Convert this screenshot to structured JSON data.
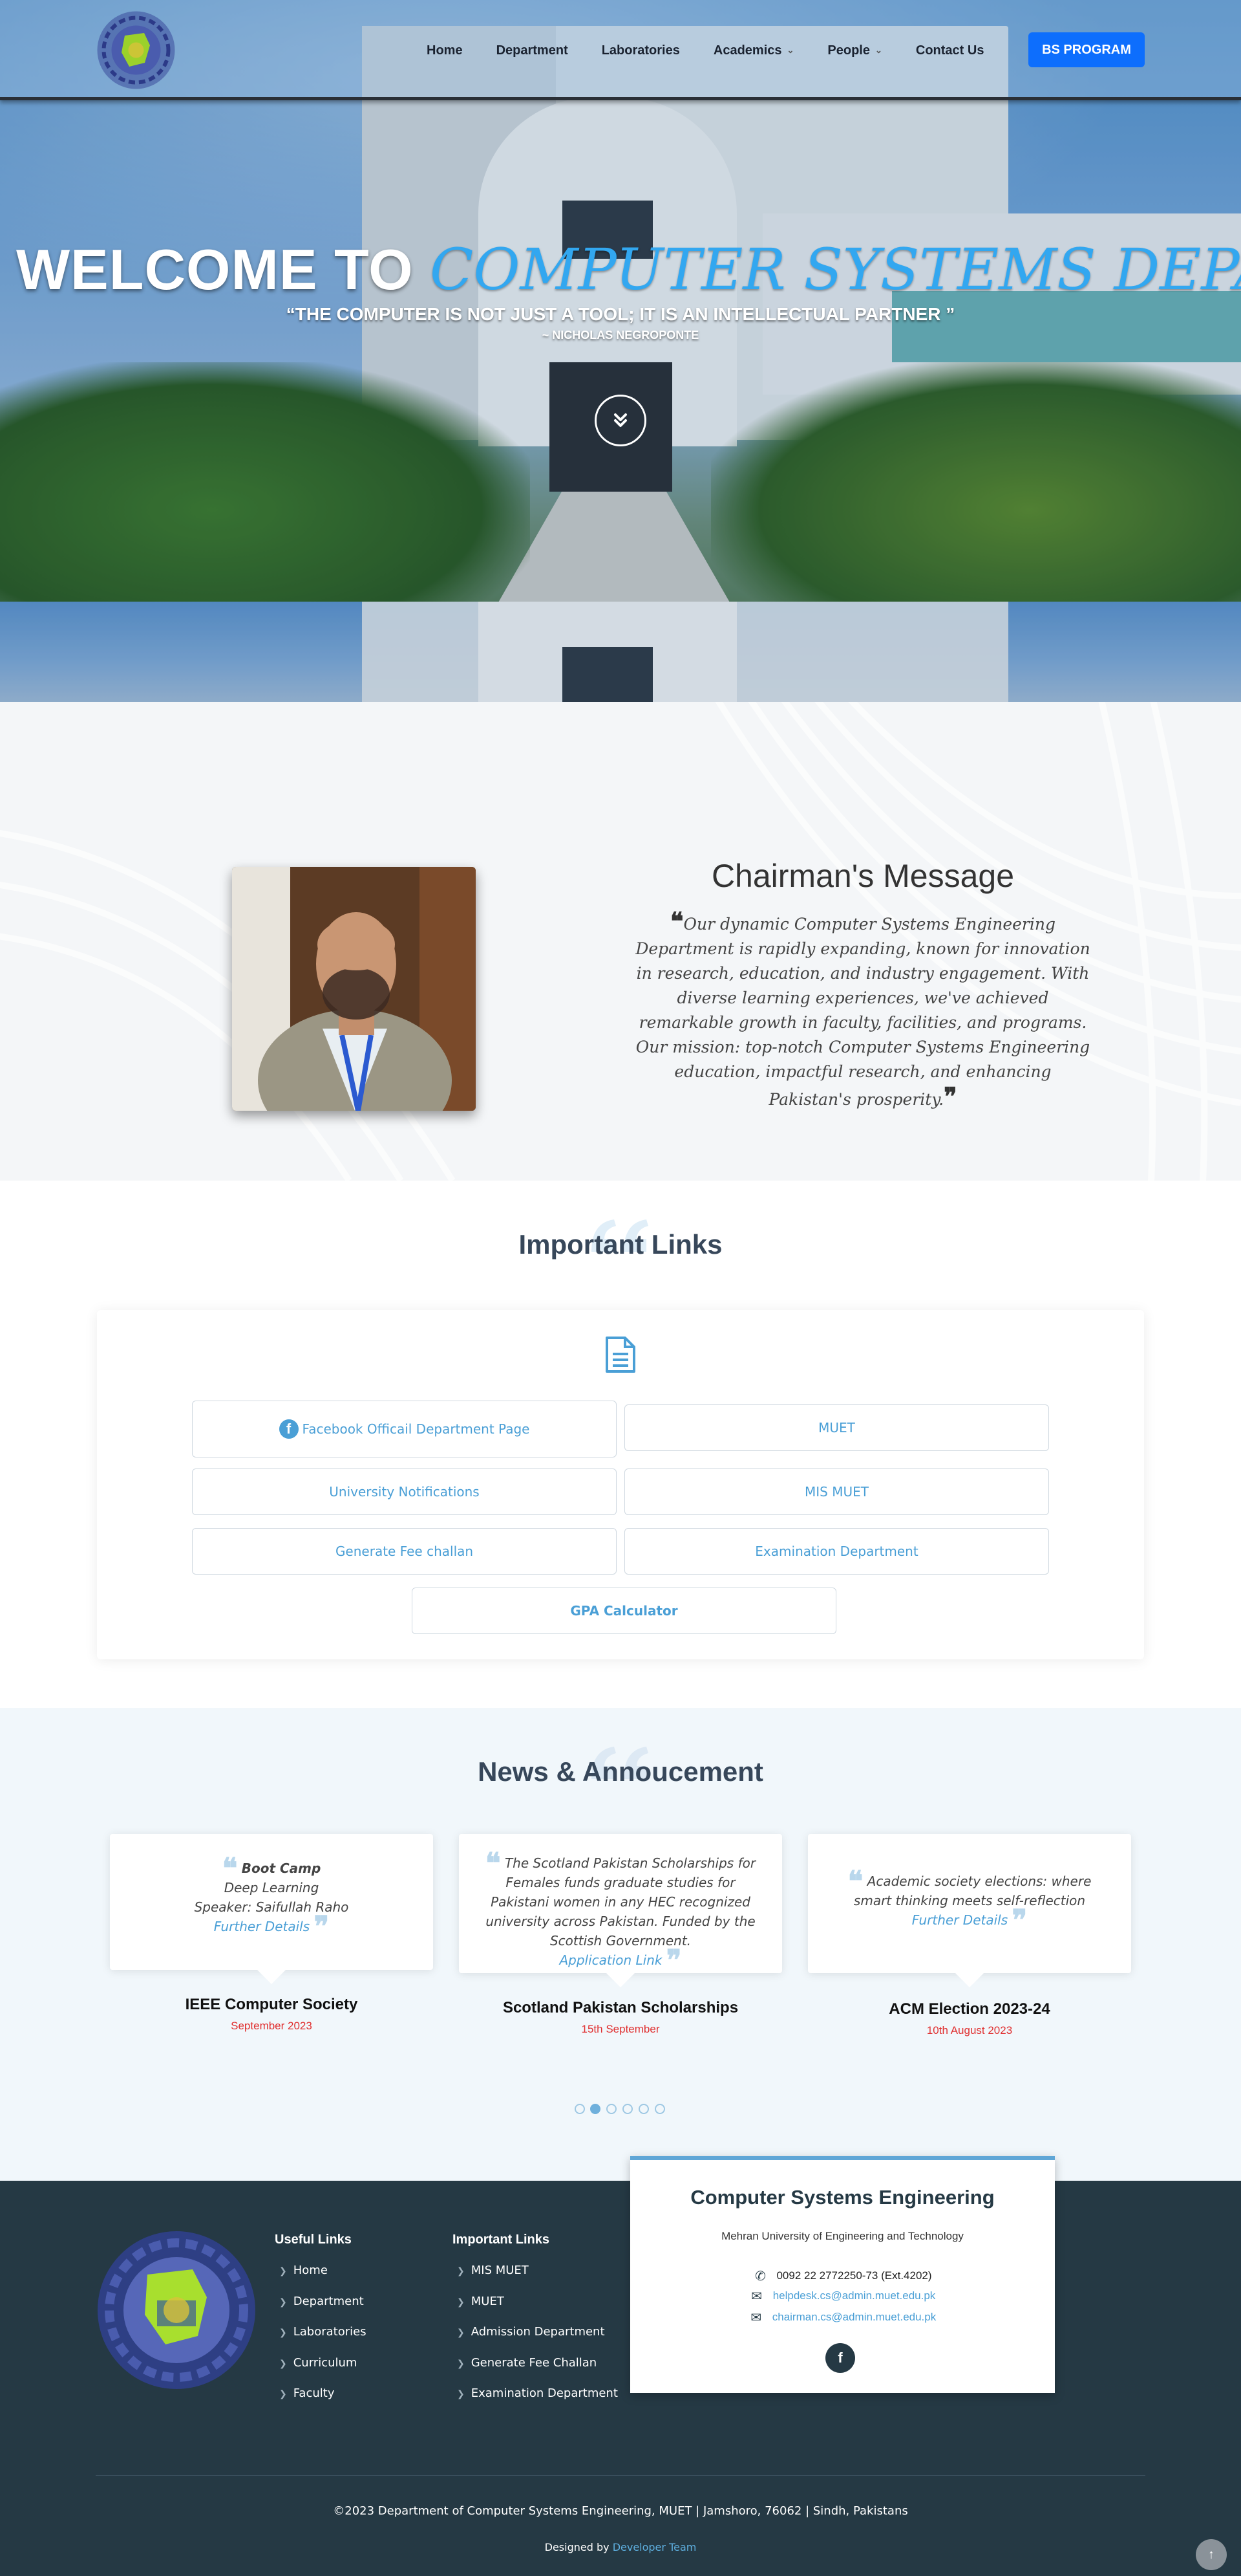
{
  "nav": {
    "items": [
      {
        "label": "Home",
        "has_dropdown": false
      },
      {
        "label": "Department",
        "has_dropdown": false
      },
      {
        "label": "Laboratories",
        "has_dropdown": false
      },
      {
        "label": "Academics",
        "has_dropdown": true
      },
      {
        "label": "People",
        "has_dropdown": true
      },
      {
        "label": "Contact Us",
        "has_dropdown": false
      }
    ],
    "cta_label": "BS PROGRAM"
  },
  "hero": {
    "title_prefix": "WELCOME TO",
    "title_accent": "COMPUTER SYSTEMS DEPARTMENT",
    "quote": "“THE COMPUTER IS NOT JUST A TOOL; IT IS AN INTELLECTUAL PARTNER ”",
    "author": "~ NICHOLAS NEGROPONTE"
  },
  "chairman": {
    "title": "Chairman's Message",
    "message": "Our dynamic Computer Systems Engineering Department is rapidly expanding, known for innovation in research, education, and industry engagement. With diverse learning experiences, we've achieved remarkable growth in faculty, facilities, and programs. Our mission: top-notch Computer Systems Engineering education, impactful research, and enhancing Pakistan's prosperity."
  },
  "links": {
    "title": "Important Links",
    "items": [
      {
        "label": "Facebook Officail Department Page"
      },
      {
        "label": "MUET"
      },
      {
        "label": "University Notifications"
      },
      {
        "label": "MIS MUET"
      },
      {
        "label": "Generate Fee challan"
      },
      {
        "label": "Examination Department"
      },
      {
        "label": "GPA Calculator"
      }
    ]
  },
  "news": {
    "title": "News & Annoucement",
    "cards": [
      {
        "heading": "Boot Camp",
        "lines": [
          "Deep Learning",
          "Speaker: Saifullah Raho"
        ],
        "link": "Further Details",
        "name": "IEEE Computer Society",
        "date": "September 2023"
      },
      {
        "heading": "",
        "lines": [
          "The Scotland Pakistan Scholarships for Females funds graduate studies for Pakistani women in any HEC recognized university across Pakistan. Funded by the Scottish Government."
        ],
        "link": "Application Link",
        "name": "Scotland Pakistan Scholarships",
        "date": "15th September"
      },
      {
        "heading": "",
        "lines": [
          "Academic society elections: where smart thinking meets self-reflection"
        ],
        "link": "Further Details",
        "name": "ACM Election 2023-24",
        "date": "10th August 2023"
      }
    ],
    "pagination": {
      "total": 6,
      "active": 2
    }
  },
  "footer": {
    "useful_links_title": "Useful Links",
    "useful_links": [
      "Home",
      "Department",
      "Laboratories",
      "Curriculum",
      "Faculty"
    ],
    "important_links_title": "Important Links",
    "important_links": [
      "MIS MUET",
      "MUET",
      "Admission Department",
      "Generate Fee Challan",
      "Examination Department"
    ],
    "contact": {
      "title": "Computer Systems Engineering",
      "subtitle": "Mehran University of Engineering and Technology",
      "phone": "0092 22 2772250-73 (Ext.4202)",
      "email1": "helpdesk.cs@admin.muet.edu.pk",
      "email2": "chairman.cs@admin.muet.edu.pk"
    },
    "copyright": "©2023 Department of Computer Systems Engineering, MUET | Jamshoro, 76062 | Sindh, Pakistans",
    "designed_by_prefix": "Designed by",
    "designed_by_link": "Developer Team"
  },
  "colors": {
    "brand_blue": "#0d6efd",
    "accent_link": "#4a9fd6",
    "footer_bg": "#253944",
    "date_red": "#e03030"
  }
}
